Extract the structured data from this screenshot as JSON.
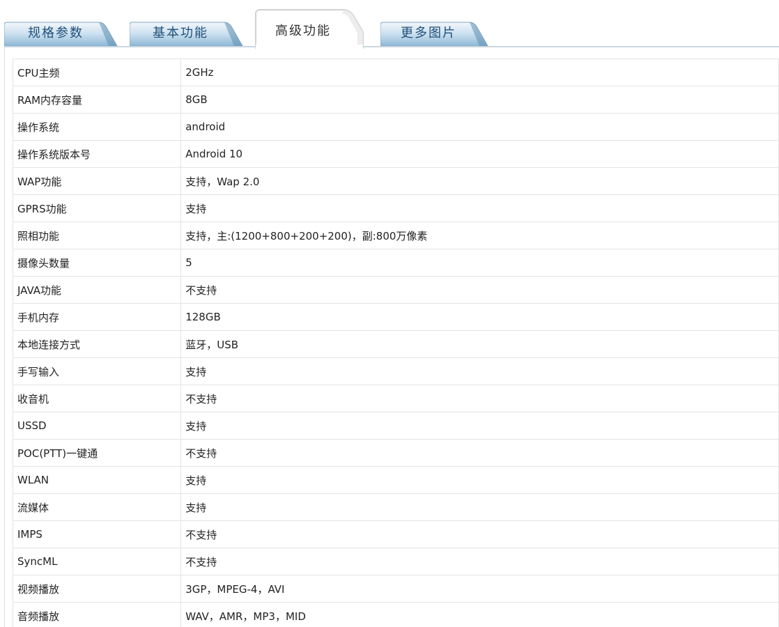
{
  "tabs": [
    {
      "label": "规格参数",
      "active": false
    },
    {
      "label": "基本功能",
      "active": false
    },
    {
      "label": "高级功能",
      "active": true
    },
    {
      "label": "更多图片",
      "active": false
    }
  ],
  "colors": {
    "tab_inactive_top": "#f2f7fb",
    "tab_inactive_bottom": "#8fb8d6",
    "tab_text": "#1e4f7a",
    "border": "#e3e3e3"
  },
  "rows": [
    {
      "label": "CPU主频",
      "value": "2GHz"
    },
    {
      "label": "RAM内存容量",
      "value": "8GB"
    },
    {
      "label": "操作系统",
      "value": "android"
    },
    {
      "label": "操作系统版本号",
      "value": "Android 10"
    },
    {
      "label": "WAP功能",
      "value": "支持，Wap 2.0"
    },
    {
      "label": "GPRS功能",
      "value": "支持"
    },
    {
      "label": "照相功能",
      "value": "支持，主:(1200+800+200+200)，副:800万像素"
    },
    {
      "label": "摄像头数量",
      "value": "5"
    },
    {
      "label": "JAVA功能",
      "value": "不支持"
    },
    {
      "label": "手机内存",
      "value": "128GB"
    },
    {
      "label": "本地连接方式",
      "value": "蓝牙，USB"
    },
    {
      "label": "手写输入",
      "value": "支持"
    },
    {
      "label": "收音机",
      "value": "不支持"
    },
    {
      "label": "USSD",
      "value": "支持"
    },
    {
      "label": "POC(PTT)一键通",
      "value": "不支持"
    },
    {
      "label": "WLAN",
      "value": "支持"
    },
    {
      "label": "流媒体",
      "value": "支持"
    },
    {
      "label": "IMPS",
      "value": "不支持"
    },
    {
      "label": "SyncML",
      "value": "不支持"
    },
    {
      "label": "视频播放",
      "value": "3GP，MPEG-4，AVI"
    },
    {
      "label": "音频播放",
      "value": "WAV，AMR，MP3，MID"
    }
  ]
}
